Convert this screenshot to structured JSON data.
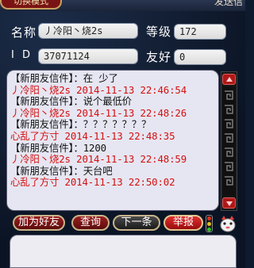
{
  "header": {
    "switch_mode_label": "切换模式",
    "send_label": "发送信"
  },
  "profile": {
    "name_label": "名称",
    "name_value": "丿冷阳丶烧2s",
    "level_label": "等级",
    "level_value": "172",
    "id_label": "I  D",
    "id_value": "37071124",
    "friendship_label": "友好",
    "friendship_value": "0"
  },
  "messages": [
    {
      "head": "【新朋友信件】：在 少了",
      "meta": "丿冷阳丶烧2s 2014-11-13 22:46:54"
    },
    {
      "head": "【新朋友信件】：说个最低价",
      "meta": "丿冷阳丶烧2s 2014-11-13 22:48:26"
    },
    {
      "head": "【新朋友信件】：？？？？？？？",
      "meta": "心乱了方寸 2014-11-13 22:48:35"
    },
    {
      "head": "【新朋友信件】：1200",
      "meta": "丿冷阳丶烧2s 2014-11-13 22:48:59"
    },
    {
      "head": "【新朋友信件】：天台吧",
      "meta": "心乱了方寸 2014-11-13 22:50:02"
    }
  ],
  "buttons": {
    "add_friend": "加为好友",
    "query": "查询",
    "next": "下一条",
    "report": "举报"
  },
  "icons": {
    "scroll_up": "arrow-up-icon",
    "scroll_down": "arrow-down-icon",
    "signal": "traffic-light-icon",
    "pet": "pet-icon"
  },
  "colors": {
    "message_text": "#101010",
    "message_meta": "#d41010",
    "button_red": "#9a2020"
  }
}
